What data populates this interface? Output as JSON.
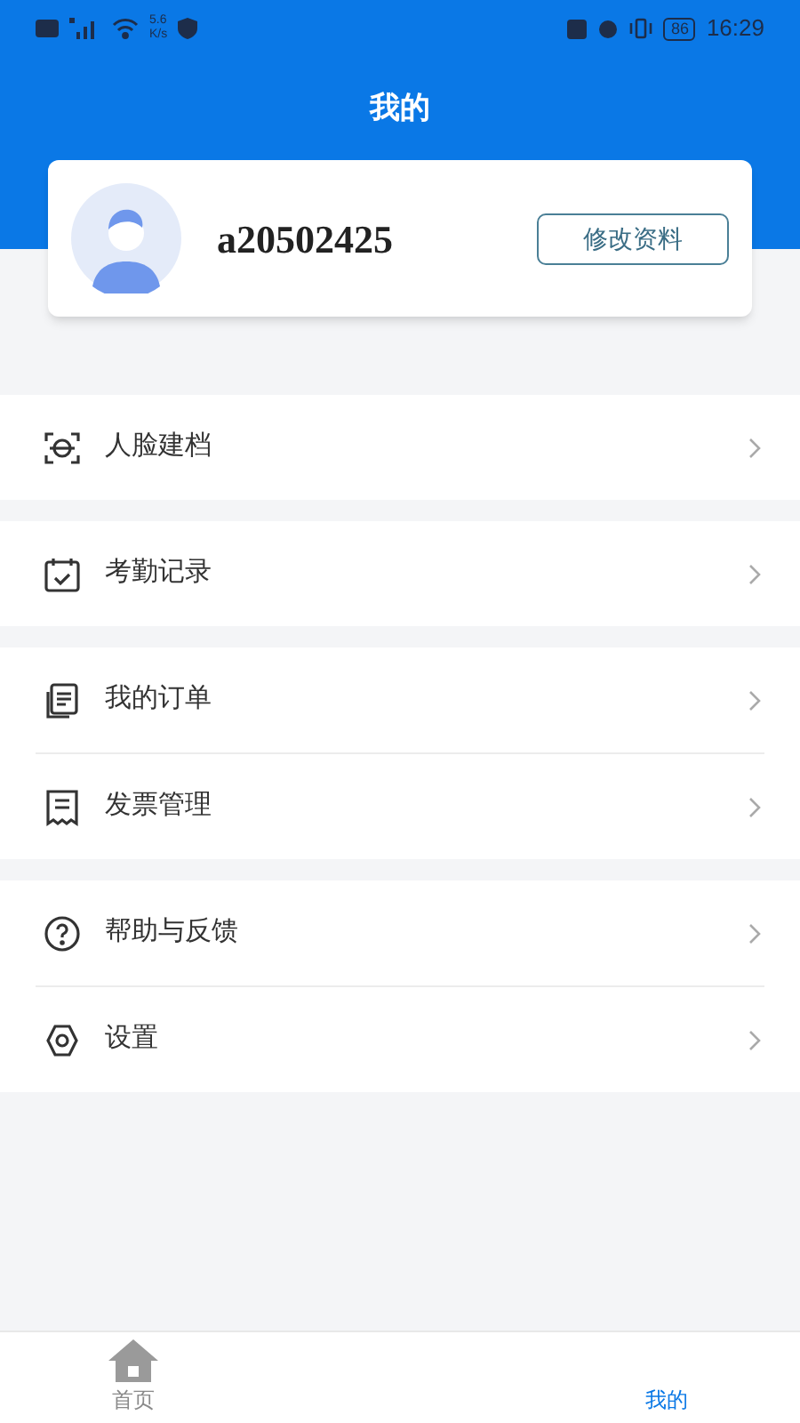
{
  "status_bar": {
    "speed": "5.6",
    "speed_unit": "K/s",
    "battery": "86",
    "time": "16:29"
  },
  "header": {
    "title": "我的"
  },
  "profile": {
    "username": "a20502425",
    "edit_button": "修改资料"
  },
  "menu_groups": [
    {
      "items": [
        {
          "label": "人脸建档",
          "kind": "face"
        }
      ]
    },
    {
      "items": [
        {
          "label": "考勤记录",
          "kind": "calendar"
        }
      ]
    },
    {
      "items": [
        {
          "label": "我的订单",
          "kind": "order"
        },
        {
          "label": "发票管理",
          "kind": "invoice"
        }
      ]
    },
    {
      "items": [
        {
          "label": "帮助与反馈",
          "kind": "help"
        },
        {
          "label": "设置",
          "kind": "settings"
        }
      ]
    }
  ],
  "bottom_nav": [
    {
      "label": "首页",
      "kind": "home",
      "selected": false
    },
    {
      "label": "我的",
      "kind": "profile",
      "selected": true
    }
  ]
}
